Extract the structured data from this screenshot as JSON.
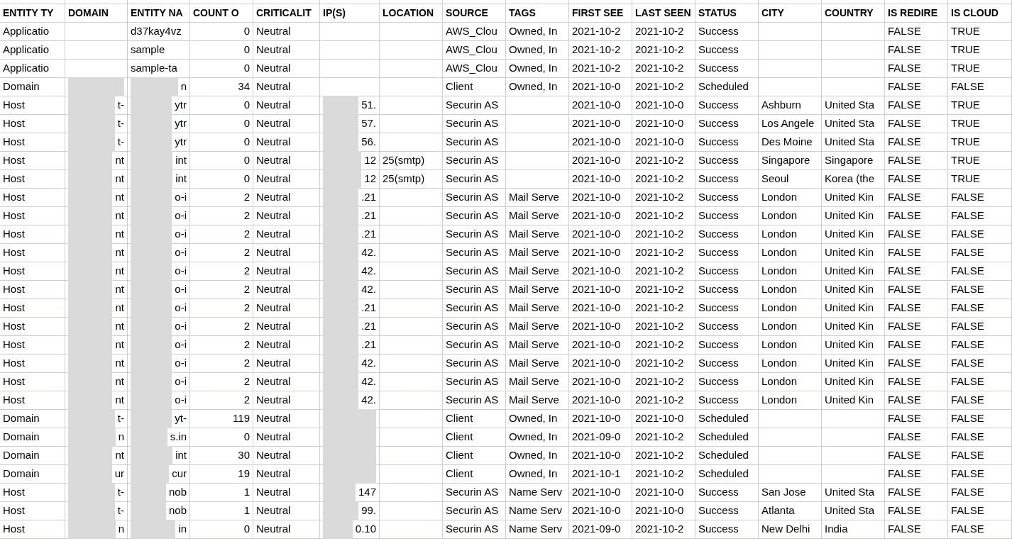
{
  "columns": [
    {
      "label": "ENTITY TY",
      "kind": "text"
    },
    {
      "label": "DOMAIN",
      "kind": "name"
    },
    {
      "label": "ENTITY NA",
      "kind": "name"
    },
    {
      "label": "COUNT O",
      "kind": "number"
    },
    {
      "label": "CRITICALIT",
      "kind": "text"
    },
    {
      "label": "IP(S)",
      "kind": "ip"
    },
    {
      "label": "LOCATION",
      "kind": "text"
    },
    {
      "label": "SOURCE",
      "kind": "text"
    },
    {
      "label": "TAGS",
      "kind": "text"
    },
    {
      "label": "FIRST SEE",
      "kind": "text"
    },
    {
      "label": "LAST SEEN",
      "kind": "text"
    },
    {
      "label": "STATUS",
      "kind": "text"
    },
    {
      "label": "CITY",
      "kind": "text"
    },
    {
      "label": "COUNTRY",
      "kind": "text"
    },
    {
      "label": "IS REDIRE",
      "kind": "text"
    },
    {
      "label": "IS CLOUD",
      "kind": "text"
    }
  ],
  "rows": [
    {
      "cells": [
        "Applicatio",
        "",
        "d37kay4vz",
        "0",
        "Neutral",
        "",
        "",
        "AWS_Clou",
        "Owned, In",
        "2021-10-2",
        "2021-10-2",
        "Success",
        "",
        "",
        "FALSE",
        "TRUE"
      ],
      "redacted_name": false,
      "redacted_ip": false
    },
    {
      "cells": [
        "Applicatio",
        "",
        "sample",
        "0",
        "Neutral",
        "",
        "",
        "AWS_Clou",
        "Owned, In",
        "2021-10-2",
        "2021-10-2",
        "Success",
        "",
        "",
        "FALSE",
        "TRUE"
      ],
      "redacted_name": false,
      "redacted_ip": false
    },
    {
      "cells": [
        "Applicatio",
        "",
        "sample-ta",
        "0",
        "Neutral",
        "",
        "",
        "AWS_Clou",
        "Owned, In",
        "2021-10-2",
        "2021-10-2",
        "Success",
        "",
        "",
        "FALSE",
        "TRUE"
      ],
      "redacted_name": false,
      "redacted_ip": false
    },
    {
      "cells": [
        "Domain",
        "",
        "n",
        "34",
        "Neutral",
        "",
        "",
        "Client",
        "Owned, In",
        "2021-10-0",
        "2021-10-2",
        "Scheduled",
        "",
        "",
        "FALSE",
        "FALSE"
      ],
      "redacted_name": true,
      "redacted_ip": false
    },
    {
      "cells": [
        "Host",
        "t-",
        "ytr",
        "0",
        "Neutral",
        "51.",
        "",
        "Securin AS",
        "",
        "2021-10-0",
        "2021-10-0",
        "Success",
        "Ashburn",
        "United Sta",
        "FALSE",
        "TRUE"
      ],
      "redacted_name": true,
      "redacted_ip": true
    },
    {
      "cells": [
        "Host",
        "t-",
        "ytr",
        "0",
        "Neutral",
        "57.",
        "",
        "Securin AS",
        "",
        "2021-10-0",
        "2021-10-0",
        "Success",
        "Los Angele",
        "United Sta",
        "FALSE",
        "TRUE"
      ],
      "redacted_name": true,
      "redacted_ip": true
    },
    {
      "cells": [
        "Host",
        "t-",
        "ytr",
        "0",
        "Neutral",
        "56.",
        "",
        "Securin AS",
        "",
        "2021-10-0",
        "2021-10-0",
        "Success",
        "Des Moine",
        "United Sta",
        "FALSE",
        "TRUE"
      ],
      "redacted_name": true,
      "redacted_ip": true
    },
    {
      "cells": [
        "Host",
        "nt",
        "int",
        "0",
        "Neutral",
        "12",
        "25(smtp)",
        "Securin AS",
        "",
        "2021-10-0",
        "2021-10-2",
        "Success",
        "Singapore",
        "Singapore",
        "FALSE",
        "TRUE"
      ],
      "redacted_name": true,
      "redacted_ip": true
    },
    {
      "cells": [
        "Host",
        "nt",
        "int",
        "0",
        "Neutral",
        "12",
        "25(smtp)",
        "Securin AS",
        "",
        "2021-10-0",
        "2021-10-2",
        "Success",
        "Seoul",
        "Korea (the",
        "FALSE",
        "TRUE"
      ],
      "redacted_name": true,
      "redacted_ip": true
    },
    {
      "cells": [
        "Host",
        "nt",
        "o-i",
        "2",
        "Neutral",
        ".21",
        "",
        "Securin AS",
        "Mail Serve",
        "2021-10-0",
        "2021-10-2",
        "Success",
        "London",
        "United Kin",
        "FALSE",
        "FALSE"
      ],
      "redacted_name": true,
      "redacted_ip": true
    },
    {
      "cells": [
        "Host",
        "nt",
        "o-i",
        "2",
        "Neutral",
        ".21",
        "",
        "Securin AS",
        "Mail Serve",
        "2021-10-0",
        "2021-10-2",
        "Success",
        "London",
        "United Kin",
        "FALSE",
        "FALSE"
      ],
      "redacted_name": true,
      "redacted_ip": true
    },
    {
      "cells": [
        "Host",
        "nt",
        "o-i",
        "2",
        "Neutral",
        ".21",
        "",
        "Securin AS",
        "Mail Serve",
        "2021-10-0",
        "2021-10-2",
        "Success",
        "London",
        "United Kin",
        "FALSE",
        "FALSE"
      ],
      "redacted_name": true,
      "redacted_ip": true
    },
    {
      "cells": [
        "Host",
        "nt",
        "o-i",
        "2",
        "Neutral",
        "42.",
        "",
        "Securin AS",
        "Mail Serve",
        "2021-10-0",
        "2021-10-2",
        "Success",
        "London",
        "United Kin",
        "FALSE",
        "FALSE"
      ],
      "redacted_name": true,
      "redacted_ip": true
    },
    {
      "cells": [
        "Host",
        "nt",
        "o-i",
        "2",
        "Neutral",
        "42.",
        "",
        "Securin AS",
        "Mail Serve",
        "2021-10-0",
        "2021-10-2",
        "Success",
        "London",
        "United Kin",
        "FALSE",
        "FALSE"
      ],
      "redacted_name": true,
      "redacted_ip": true
    },
    {
      "cells": [
        "Host",
        "nt",
        "o-i",
        "2",
        "Neutral",
        "42.",
        "",
        "Securin AS",
        "Mail Serve",
        "2021-10-0",
        "2021-10-2",
        "Success",
        "London",
        "United Kin",
        "FALSE",
        "FALSE"
      ],
      "redacted_name": true,
      "redacted_ip": true
    },
    {
      "cells": [
        "Host",
        "nt",
        "o-i",
        "2",
        "Neutral",
        ".21",
        "",
        "Securin AS",
        "Mail Serve",
        "2021-10-0",
        "2021-10-2",
        "Success",
        "London",
        "United Kin",
        "FALSE",
        "FALSE"
      ],
      "redacted_name": true,
      "redacted_ip": true
    },
    {
      "cells": [
        "Host",
        "nt",
        "o-i",
        "2",
        "Neutral",
        ".21",
        "",
        "Securin AS",
        "Mail Serve",
        "2021-10-0",
        "2021-10-2",
        "Success",
        "London",
        "United Kin",
        "FALSE",
        "FALSE"
      ],
      "redacted_name": true,
      "redacted_ip": true
    },
    {
      "cells": [
        "Host",
        "nt",
        "o-i",
        "2",
        "Neutral",
        ".21",
        "",
        "Securin AS",
        "Mail Serve",
        "2021-10-0",
        "2021-10-2",
        "Success",
        "London",
        "United Kin",
        "FALSE",
        "FALSE"
      ],
      "redacted_name": true,
      "redacted_ip": true
    },
    {
      "cells": [
        "Host",
        "nt",
        "o-i",
        "2",
        "Neutral",
        "42.",
        "",
        "Securin AS",
        "Mail Serve",
        "2021-10-0",
        "2021-10-2",
        "Success",
        "London",
        "United Kin",
        "FALSE",
        "FALSE"
      ],
      "redacted_name": true,
      "redacted_ip": true
    },
    {
      "cells": [
        "Host",
        "nt",
        "o-i",
        "2",
        "Neutral",
        "42.",
        "",
        "Securin AS",
        "Mail Serve",
        "2021-10-0",
        "2021-10-2",
        "Success",
        "London",
        "United Kin",
        "FALSE",
        "FALSE"
      ],
      "redacted_name": true,
      "redacted_ip": true
    },
    {
      "cells": [
        "Host",
        "nt",
        "o-i",
        "2",
        "Neutral",
        "42.",
        "",
        "Securin AS",
        "Mail Serve",
        "2021-10-0",
        "2021-10-2",
        "Success",
        "London",
        "United Kin",
        "FALSE",
        "FALSE"
      ],
      "redacted_name": true,
      "redacted_ip": true
    },
    {
      "cells": [
        "Domain",
        "t-",
        "yt-",
        "119",
        "Neutral",
        "",
        "",
        "Client",
        "Owned, In",
        "2021-10-0",
        "2021-10-0",
        "Scheduled",
        "",
        "",
        "FALSE",
        "FALSE"
      ],
      "redacted_name": true,
      "redacted_ip": true
    },
    {
      "cells": [
        "Domain",
        "n",
        "s.in",
        "0",
        "Neutral",
        "",
        "",
        "Client",
        "Owned, In",
        "2021-09-0",
        "2021-10-2",
        "Scheduled",
        "",
        "",
        "FALSE",
        "FALSE"
      ],
      "redacted_name": true,
      "redacted_ip": true
    },
    {
      "cells": [
        "Domain",
        "nt",
        "int",
        "30",
        "Neutral",
        "",
        "",
        "Client",
        "Owned, In",
        "2021-10-0",
        "2021-10-2",
        "Scheduled",
        "",
        "",
        "FALSE",
        "FALSE"
      ],
      "redacted_name": true,
      "redacted_ip": true
    },
    {
      "cells": [
        "Domain",
        "ur",
        "cur",
        "19",
        "Neutral",
        "",
        "",
        "Client",
        "Owned, In",
        "2021-10-1",
        "2021-10-2",
        "Scheduled",
        "",
        "",
        "FALSE",
        "FALSE"
      ],
      "redacted_name": true,
      "redacted_ip": true
    },
    {
      "cells": [
        "Host",
        "t-",
        "nob",
        "1",
        "Neutral",
        "147",
        "",
        "Securin AS",
        "Name Serv",
        "2021-10-0",
        "2021-10-0",
        "Success",
        "San Jose",
        "United Sta",
        "FALSE",
        "FALSE"
      ],
      "redacted_name": true,
      "redacted_ip": true
    },
    {
      "cells": [
        "Host",
        "t-",
        "nob",
        "1",
        "Neutral",
        "99.",
        "",
        "Securin AS",
        "Name Serv",
        "2021-10-0",
        "2021-10-0",
        "Success",
        "Atlanta",
        "United Sta",
        "FALSE",
        "FALSE"
      ],
      "redacted_name": true,
      "redacted_ip": true
    },
    {
      "cells": [
        "Host",
        "n",
        "in",
        "0",
        "Neutral",
        "0.10",
        "",
        "Securin AS",
        "Name Serv",
        "2021-09-0",
        "2021-10-2",
        "Success",
        "New Delhi",
        "India",
        "FALSE",
        "FALSE"
      ],
      "redacted_name": true,
      "redacted_ip": true
    }
  ]
}
